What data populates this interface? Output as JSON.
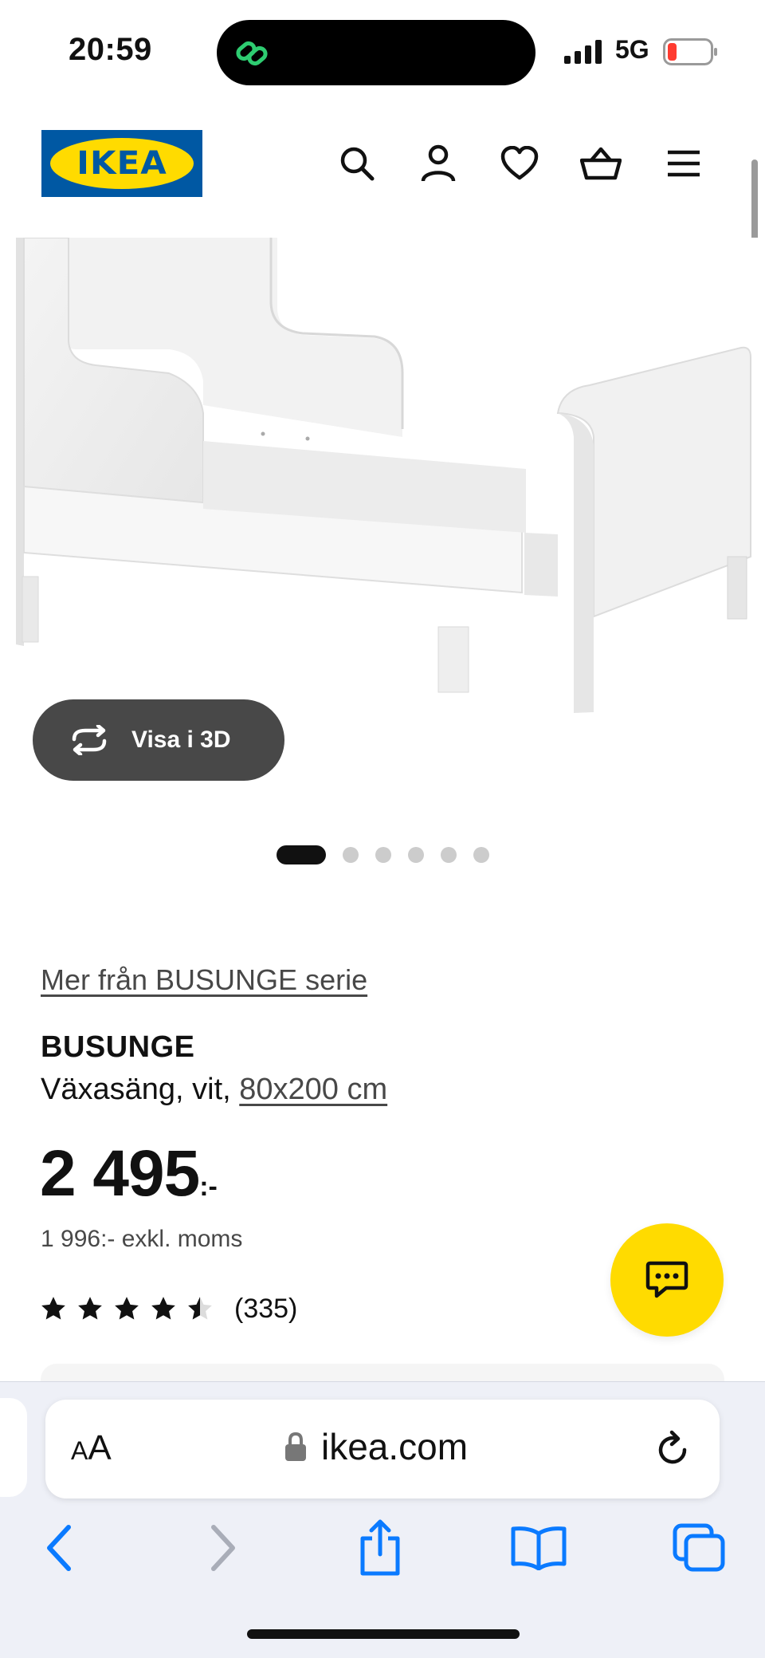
{
  "status_bar": {
    "time": "20:59",
    "network": "5G"
  },
  "header": {
    "logo_text": "IKEA",
    "icons": [
      "search-icon",
      "account-icon",
      "favorites-icon",
      "cart-icon",
      "menu-icon"
    ]
  },
  "gallery": {
    "view_3d_label": "Visa i 3D",
    "dot_count": 6,
    "active_dot": 0
  },
  "product": {
    "series_link": "Mer från BUSUNGE serie",
    "name": "BUSUNGE",
    "desc_prefix": "Växasäng, vit, ",
    "size_link": "80x200 cm",
    "price_main": "2 495",
    "price_suffix": ":-",
    "price_excl": "1 996:- exkl. moms",
    "rating_value": 4.5,
    "rating_max": 5,
    "rating_count": "(335)"
  },
  "safari": {
    "aa_small": "A",
    "aa_large": "A",
    "url": "ikea.com"
  },
  "colors": {
    "ikea_blue": "#0058a3",
    "ikea_yellow": "#ffdb00",
    "safari_blue": "#0a7aff"
  }
}
